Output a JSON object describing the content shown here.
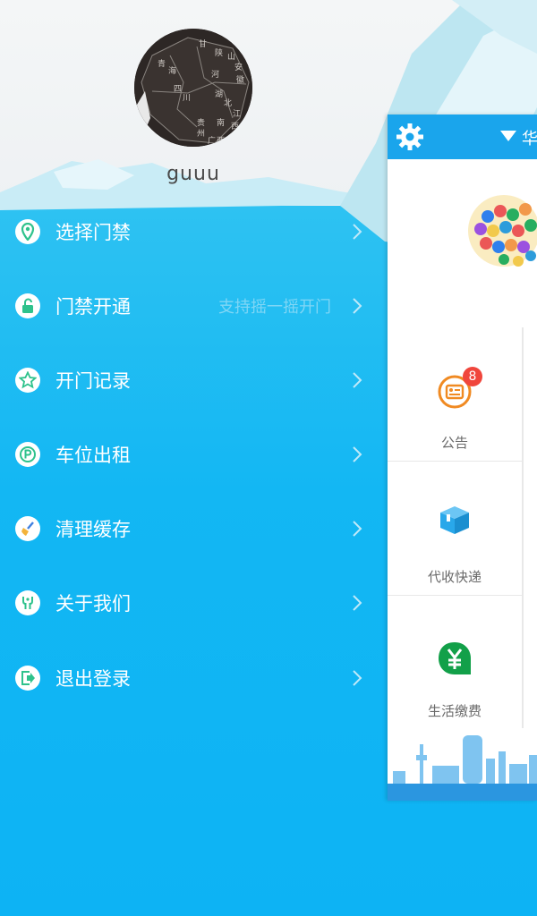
{
  "user": {
    "name": "guuu",
    "avatar_map_labels": [
      "青",
      "海",
      "甘",
      "陕",
      "山",
      "安",
      "四",
      "川",
      "河",
      "徽",
      "湖",
      "北",
      "江",
      "西",
      "贵",
      "州",
      "南",
      "广",
      "西"
    ]
  },
  "menu": {
    "items": [
      {
        "label": "选择门禁",
        "hint": "",
        "icon": "location-pin-icon"
      },
      {
        "label": "门禁开通",
        "hint": "支持摇一摇开门",
        "icon": "unlock-icon"
      },
      {
        "label": "开门记录",
        "hint": "",
        "icon": "star-icon"
      },
      {
        "label": "车位出租",
        "hint": "",
        "icon": "parking-icon"
      },
      {
        "label": "清理缓存",
        "hint": "",
        "icon": "broom-icon"
      },
      {
        "label": "关于我们",
        "hint": "",
        "icon": "about-icon"
      },
      {
        "label": "退出登录",
        "hint": "",
        "icon": "logout-icon"
      }
    ]
  },
  "panel": {
    "location": "华",
    "grid": [
      {
        "label": "公告",
        "badge": "8",
        "icon": "notice-icon",
        "color": "#f08a22"
      },
      {
        "label": "代收快递",
        "badge": "",
        "icon": "package-icon",
        "color": "#29a8ea"
      },
      {
        "label": "生活缴费",
        "badge": "",
        "icon": "yen-leaf-icon",
        "color": "#12a049"
      }
    ]
  },
  "colors": {
    "accent": "#1aa5ec",
    "water": "#13b6f2",
    "icon_green": "#2fc28c"
  }
}
